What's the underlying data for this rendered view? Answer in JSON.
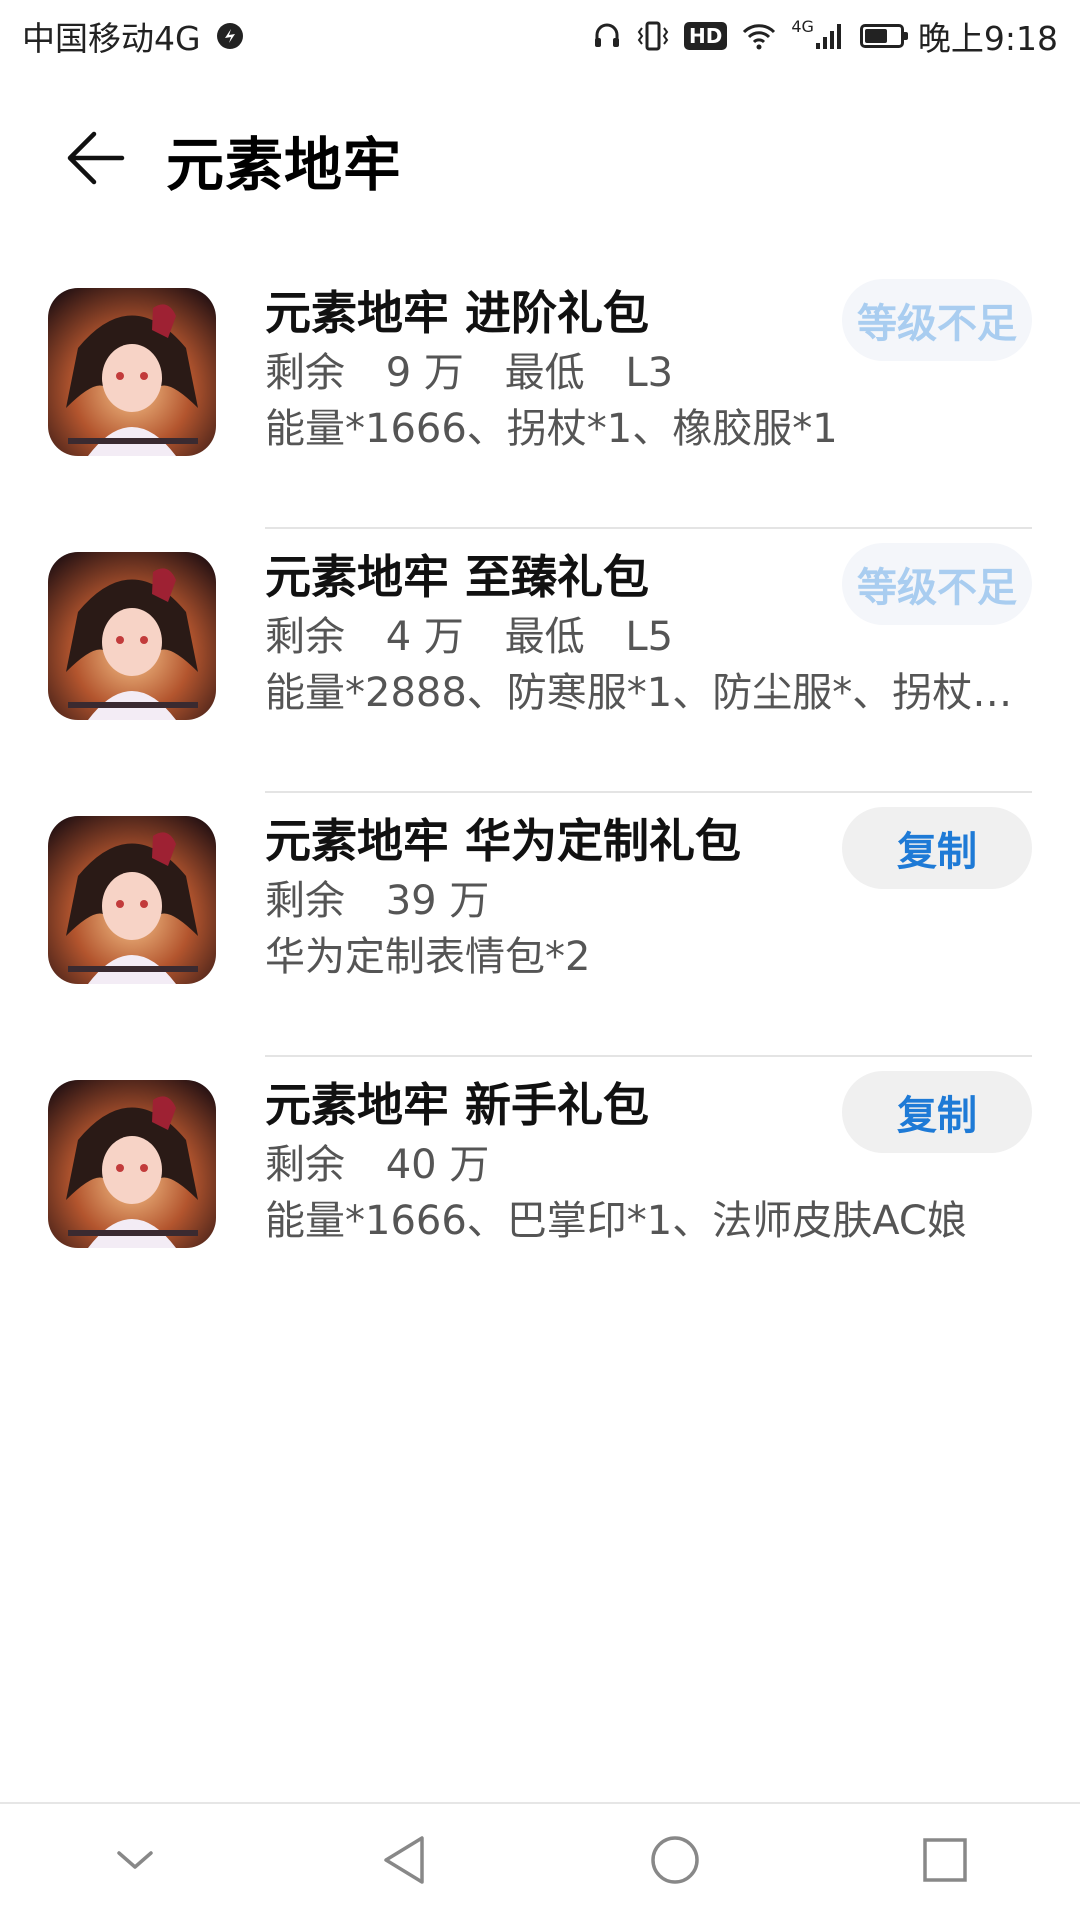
{
  "status_bar": {
    "carrier": "中国移动4G",
    "network_type": "4G",
    "time": "晚上9:18",
    "hd_label": "HD",
    "battery_level": 0.65,
    "icons": [
      "carrier-data-icon",
      "headphone-icon",
      "vibrate-icon",
      "hd-icon",
      "wifi-icon",
      "cellular-signal-icon",
      "battery-icon"
    ]
  },
  "header": {
    "title": "元素地牢",
    "back_icon": "arrow-left-icon"
  },
  "gifts": [
    {
      "title": "元素地牢 进阶礼包",
      "remaining_label": "剩余",
      "remaining_value": "9 万",
      "min_label": "最低",
      "min_value": "L3",
      "contents": "能量*1666、拐杖*1、橡胶服*1",
      "button_label": "等级不足",
      "button_state": "disabled"
    },
    {
      "title": "元素地牢 至臻礼包",
      "remaining_label": "剩余",
      "remaining_value": "4 万",
      "min_label": "最低",
      "min_value": "L5",
      "contents": "能量*2888、防寒服*1、防尘服*、拐杖*…",
      "button_label": "等级不足",
      "button_state": "disabled"
    },
    {
      "title": "元素地牢 华为定制礼包",
      "remaining_label": "剩余",
      "remaining_value": "39 万",
      "contents": "华为定制表情包*2",
      "button_label": "复制",
      "button_state": "active"
    },
    {
      "title": "元素地牢 新手礼包",
      "remaining_label": "剩余",
      "remaining_value": "40 万",
      "contents": "能量*1666、巴掌印*1、法师皮肤AC娘",
      "button_label": "复制",
      "button_state": "active"
    }
  ],
  "colors": {
    "accent": "#1e7ad6",
    "disabled_text": "#a9cdf0",
    "disabled_bg": "#f4f6fa",
    "active_bg": "#f0f0f0",
    "divider": "#e4e4e4"
  },
  "nav_bar": {
    "icons": [
      "chevron-down-icon",
      "back-triangle-icon",
      "home-circle-icon",
      "recents-square-icon"
    ]
  }
}
